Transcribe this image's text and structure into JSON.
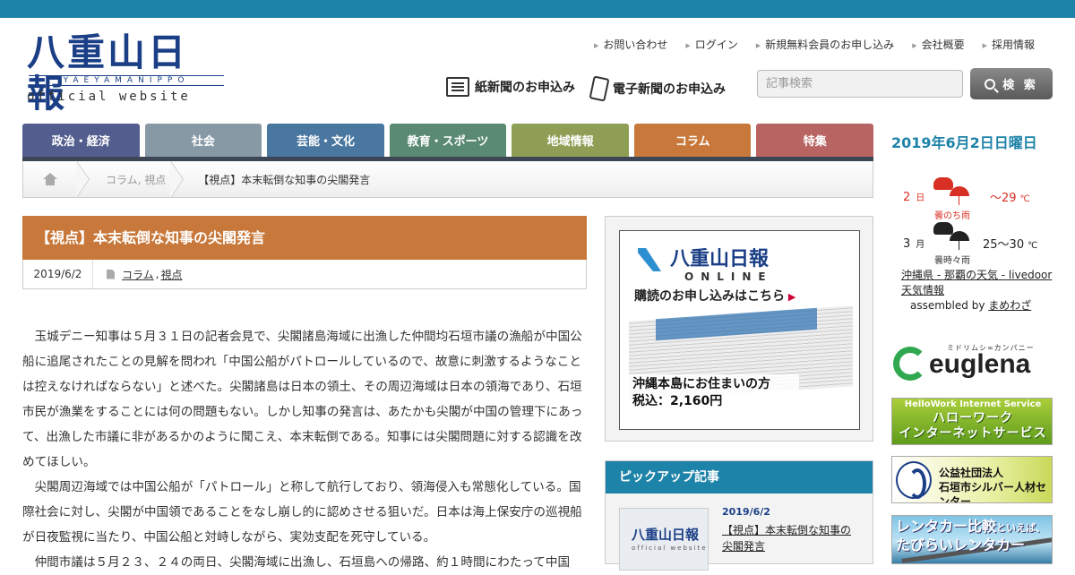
{
  "site": {
    "logo_main": "八重山日報",
    "logo_sub": "YAEYAMANIPPO",
    "logo_tag": "official website"
  },
  "header": {
    "links": [
      "お問い合わせ",
      "ログイン",
      "新規無料会員のお申し込み",
      "会社概要",
      "採用情報"
    ],
    "paper_subscribe": "紙新聞のお申込み",
    "digital_subscribe": "電子新聞のお申込み",
    "search_placeholder": "記事検索",
    "search_button": "検 索"
  },
  "nav": {
    "items": [
      {
        "label": "政治・経済",
        "color": "#535d8e"
      },
      {
        "label": "社会",
        "color": "#8899a6"
      },
      {
        "label": "芸能・文化",
        "color": "#4a77a0"
      },
      {
        "label": "教育・スポーツ",
        "color": "#5a8a73"
      },
      {
        "label": "地域情報",
        "color": "#8e9f55"
      },
      {
        "label": "コラム",
        "color": "#c8783a"
      },
      {
        "label": "特集",
        "color": "#b86462"
      }
    ]
  },
  "breadcrumb": {
    "category": "コラム, 視点",
    "current": "【視点】本末転倒な知事の尖閣発言"
  },
  "article": {
    "title": "【視点】本末転倒な知事の尖閣発言",
    "date": "2019/6/2",
    "cat1": "コラム",
    "cat_sep": ",",
    "cat2": "視点",
    "paragraphs": [
      "玉城デニー知事は５月３１日の記者会見で、尖閣諸島海域に出漁した仲間均石垣市議の漁船が中国公船に追尾されたことの見解を問われ「中国公船がパトロールしているので、故意に刺激するようなことは控えなければならない」と述べた。尖閣諸島は日本の領土、その周辺海域は日本の領海であり、石垣市民が漁業をすることには何の問題もない。しかし知事の発言は、あたかも尖閣が中国の管理下にあって、出漁した市議に非があるかのように聞こえ、本末転倒である。知事には尖閣問題に対する認識を改めてほしい。",
      "尖閣周辺海域では中国公船が「パトロール」と称して航行しており、領海侵入も常態化している。国際社会に対し、尖閣が中国領であることをなし崩し的に認めさせる狙いだ。日本は海上保安庁の巡視船が日夜監視に当たり、中国公船と対峙しながら、実効支配を死守している。",
      "仲間市議は５月２３、２４の両日、尖閣海域に出漁し、石垣島への帰路、約１時間にわたって中国"
    ]
  },
  "promo": {
    "logo": "八重山日報",
    "sub": "YAEYAMANIPPO",
    "online": "ONLINE",
    "cta": "購読のお申し込みはこちら",
    "band_line1": "沖縄本島にお住まいの方",
    "band_line2": "税込：2,160円"
  },
  "pickup": {
    "heading": "ピックアップ記事",
    "thumb_logo": "八重山日報",
    "thumb_tag": "official website",
    "date": "2019/6/2",
    "title": "【視点】本末転倒な知事の尖閣発言"
  },
  "sidebar": {
    "date": "2019年6月2日日曜日",
    "weather": [
      {
        "day": "2",
        "unit": "日",
        "label": "曇のち雨",
        "temp": "～29",
        "temp_unit": "℃",
        "color": "#d93025",
        "cloud": "#d93025"
      },
      {
        "day": "3",
        "unit": "月",
        "label": "曇時々雨",
        "temp": "25～30",
        "temp_unit": "℃",
        "color": "#222222",
        "cloud": "#222222"
      }
    ],
    "weather_source": "沖縄県 - 那覇の天気 - livedoor 天気情報",
    "assembled_prefix": "assembled by",
    "assembled_by": "まめわざ",
    "ads": {
      "euglena_kana": "ミドリムシ∞カンパニー",
      "euglena_word": "euglena",
      "hellowork_top": "HelloWork Internet Service",
      "hellowork_line1": "ハローワーク",
      "hellowork_line2": "インターネットサービス",
      "silver_line1": "公益社団法人",
      "silver_line2": "石垣市シルバー人材センター",
      "rent_line1": "レンタカー比較",
      "rent_small": "といえば、",
      "rent_line2": "たびらいレンタカー"
    }
  }
}
